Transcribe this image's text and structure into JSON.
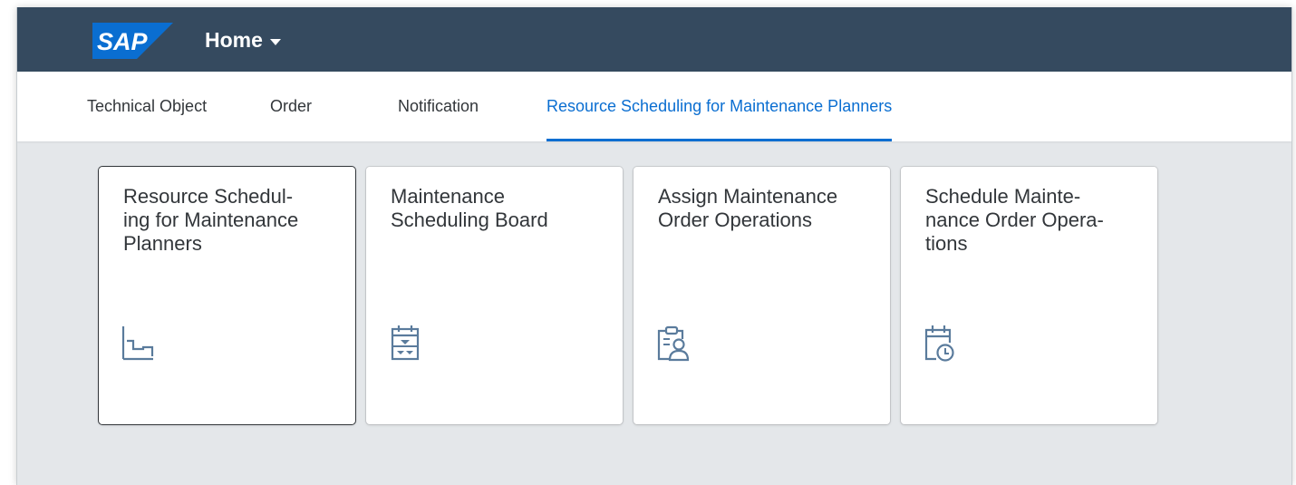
{
  "shell": {
    "logo_text": "SAP",
    "home_label": "Home",
    "colors": {
      "shellbar": "#354a5f",
      "accent": "#0a6ed1",
      "logo": "#0a6ed1",
      "icon": "#5a7b9c"
    }
  },
  "tabs": [
    {
      "label": "Technical Object",
      "active": false
    },
    {
      "label": "Order",
      "active": false
    },
    {
      "label": "Notification",
      "active": false
    },
    {
      "label": "Resource Scheduling for Maintenance Planners",
      "active": true
    }
  ],
  "tiles": [
    {
      "title": "Resource Schedul-\ning for Maintenance\nPlanners",
      "icon": "step-chart-icon",
      "focused": true
    },
    {
      "title": "Maintenance\nScheduling Board",
      "icon": "planning-calendar-icon",
      "focused": false
    },
    {
      "title": "Assign Maintenance\nOrder Operations",
      "icon": "clipboard-person-icon",
      "focused": false
    },
    {
      "title": "Schedule Mainte-\nnance Order Opera-\ntions",
      "icon": "calendar-clock-icon",
      "focused": false
    }
  ]
}
